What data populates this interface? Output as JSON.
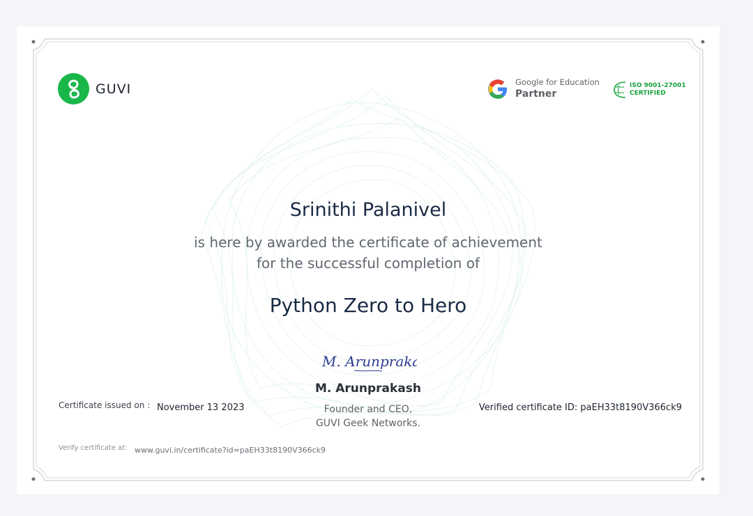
{
  "brand": {
    "name": "GUVI"
  },
  "partner": {
    "line1": "Google for Education",
    "line2": "Partner"
  },
  "iso": {
    "line1": "ISO 9001-27001",
    "line2": "CERTIFIED"
  },
  "certificate": {
    "recipient": "Srinithi Palanivel",
    "award_line1": "is here by awarded the certificate of achievement",
    "award_line2": "for the successful completion of",
    "course": "Python Zero to Hero",
    "signature_text": "M. Arunprakash",
    "signer_name": "M. Arunprakash",
    "signer_role1": "Founder and CEO,",
    "signer_role2": "GUVI Geek Networks.",
    "issued_label": "Certificate issued on :",
    "issued_date": "November 13 2023",
    "verified_id": "Verified certificate ID: paEH33t8190V366ck9",
    "verify_label": "Verify certificate at:",
    "verify_url": "www.guvi.in/certificate?id=paEH33t8190V366ck9"
  },
  "colors": {
    "brand_green": "#19b74a",
    "title_navy": "#1a2a44",
    "body_gray": "#606770",
    "frame": "#c9ced4"
  },
  "icons": [
    "guvi-logo-icon",
    "google-g-icon",
    "iso-badge-icon",
    "signature-image"
  ]
}
